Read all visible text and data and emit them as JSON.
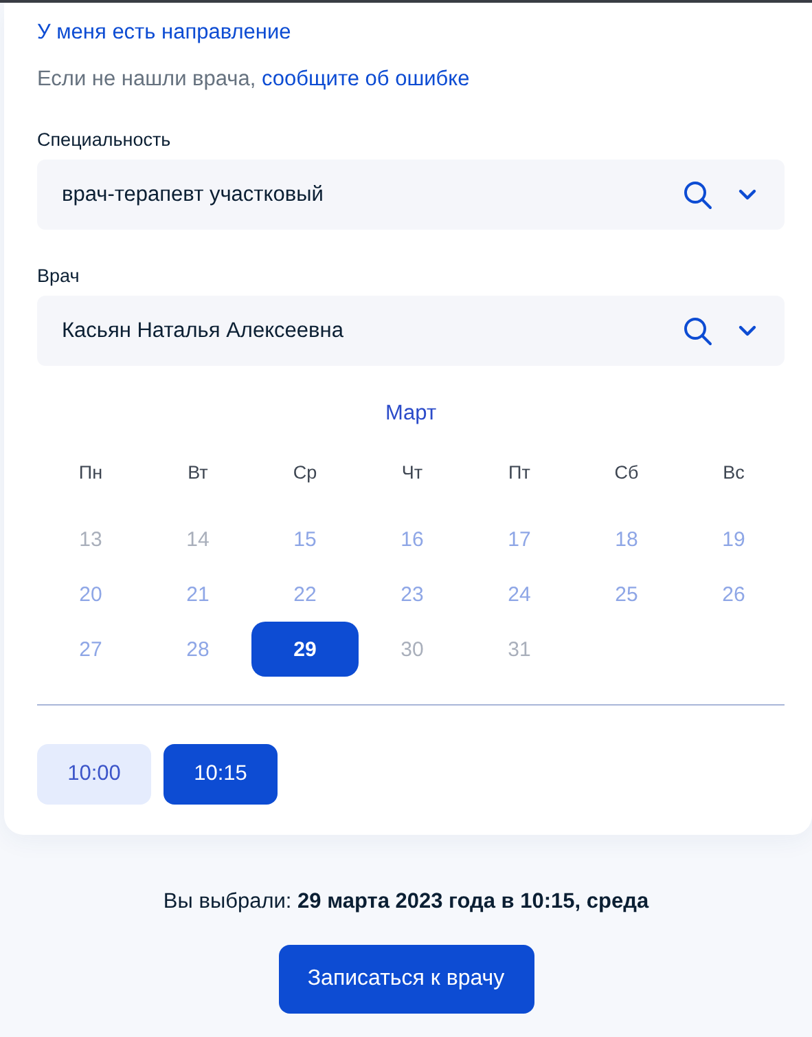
{
  "referral_link": "У меня есть направление",
  "report_note": {
    "text": "Если не нашли врача,",
    "link": "сообщите об ошибке"
  },
  "fields": [
    {
      "label": "Специальность",
      "value": "врач-терапевт участковый"
    },
    {
      "label": "Врач",
      "value": "Касьян Наталья Алексеевна"
    }
  ],
  "calendar": {
    "month": "Март",
    "weekdays": [
      "Пн",
      "Вт",
      "Ср",
      "Чт",
      "Пт",
      "Сб",
      "Вс"
    ],
    "days": [
      {
        "label": "13",
        "available": false,
        "selected": false
      },
      {
        "label": "14",
        "available": false,
        "selected": false
      },
      {
        "label": "15",
        "available": true,
        "selected": false
      },
      {
        "label": "16",
        "available": true,
        "selected": false
      },
      {
        "label": "17",
        "available": true,
        "selected": false
      },
      {
        "label": "18",
        "available": true,
        "selected": false
      },
      {
        "label": "19",
        "available": true,
        "selected": false
      },
      {
        "label": "20",
        "available": true,
        "selected": false
      },
      {
        "label": "21",
        "available": true,
        "selected": false
      },
      {
        "label": "22",
        "available": true,
        "selected": false
      },
      {
        "label": "23",
        "available": true,
        "selected": false
      },
      {
        "label": "24",
        "available": true,
        "selected": false
      },
      {
        "label": "25",
        "available": true,
        "selected": false
      },
      {
        "label": "26",
        "available": true,
        "selected": false
      },
      {
        "label": "27",
        "available": true,
        "selected": false
      },
      {
        "label": "28",
        "available": true,
        "selected": false
      },
      {
        "label": "29",
        "available": true,
        "selected": true
      },
      {
        "label": "30",
        "available": false,
        "selected": false
      },
      {
        "label": "31",
        "available": false,
        "selected": false
      }
    ]
  },
  "time_slots": [
    {
      "label": "10:00",
      "selected": false
    },
    {
      "label": "10:15",
      "selected": true
    }
  ],
  "summary": "Вы выбрали: **29 марта 2023 года в 10:15, среда**",
  "submit_button": "Записаться к врачу"
}
